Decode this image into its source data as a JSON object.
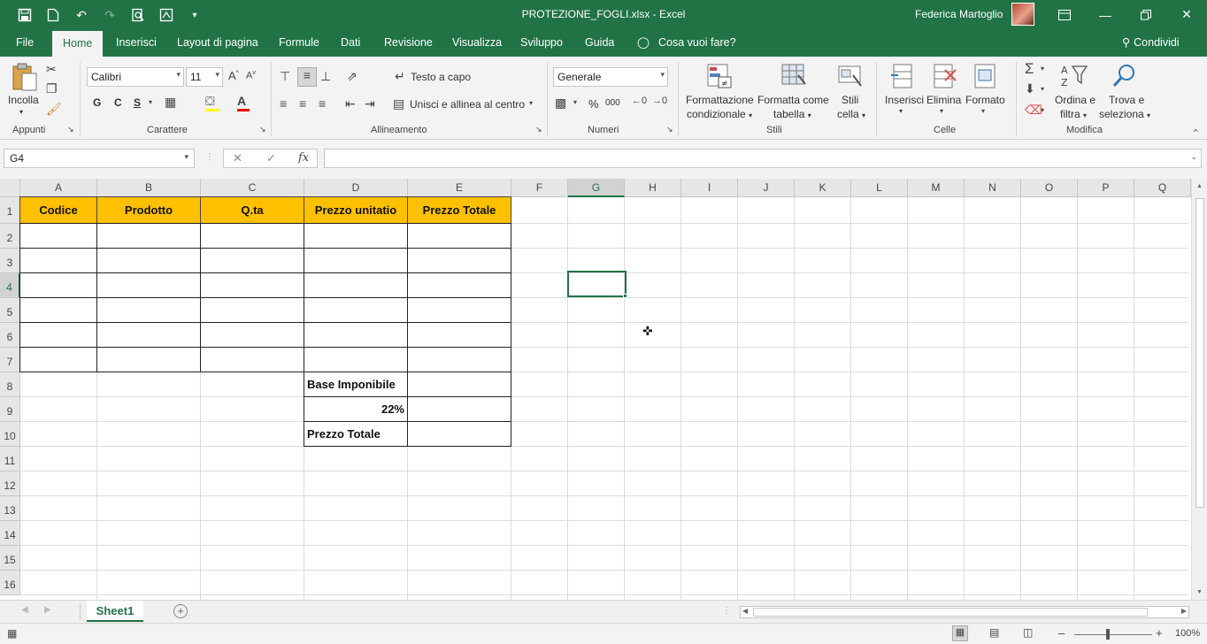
{
  "window": {
    "title": "PROTEZIONE_FOGLI.xlsx  -  Excel",
    "user": "Federica Martoglio",
    "brand_color": "#217346"
  },
  "tabs": [
    "File",
    "Home",
    "Inserisci",
    "Layout di pagina",
    "Formule",
    "Dati",
    "Revisione",
    "Visualizza",
    "Sviluppo",
    "Guida"
  ],
  "tell_me": "Cosa vuoi fare?",
  "share": "Condividi",
  "ribbon": {
    "clipboard": {
      "paste": "Incolla",
      "label": "Appunti"
    },
    "font": {
      "name": "Calibri",
      "size": "11",
      "bold": "G",
      "italic": "C",
      "underline": "S",
      "label": "Carattere"
    },
    "alignment": {
      "wrap": "Testo a capo",
      "merge": "Unisci e allinea al centro",
      "label": "Allineamento"
    },
    "number": {
      "format": "Generale",
      "percent": "%",
      "thousands": "000",
      "label": "Numeri"
    },
    "styles": {
      "cond_1": "Formattazione",
      "cond_2": "condizionale",
      "table_1": "Formatta come",
      "table_2": "tabella",
      "cell_1": "Stili",
      "cell_2": "cella",
      "label": "Stili"
    },
    "cells": {
      "insert": "Inserisci",
      "delete": "Elimina",
      "format": "Formato",
      "label": "Celle"
    },
    "editing": {
      "sort_1": "Ordina e",
      "sort_2": "filtra",
      "find_1": "Trova e",
      "find_2": "seleziona",
      "label": "Modifica"
    }
  },
  "formula_bar": {
    "name_box": "G4",
    "fx": "fx",
    "value": ""
  },
  "columns": [
    "A",
    "B",
    "C",
    "D",
    "E",
    "F",
    "G",
    "H",
    "I",
    "J",
    "K",
    "L",
    "M",
    "N",
    "O",
    "P",
    "Q"
  ],
  "rows": [
    "1",
    "2",
    "3",
    "4",
    "5",
    "6",
    "7",
    "8",
    "9",
    "10",
    "11",
    "12",
    "13",
    "14",
    "15",
    "16"
  ],
  "selected_cell": {
    "column": "G",
    "row": "4"
  },
  "table": {
    "headers": [
      "Codice",
      "Prodotto",
      "Q.ta",
      "Prezzo unitatio",
      "Prezzo Totale"
    ],
    "header_fill": "#ffc000",
    "summary": {
      "base": "Base Imponibile",
      "vat": "22%",
      "total": "Prezzo Totale"
    }
  },
  "sheet": {
    "tab": "Sheet1"
  },
  "status": {
    "zoom": "100%"
  }
}
